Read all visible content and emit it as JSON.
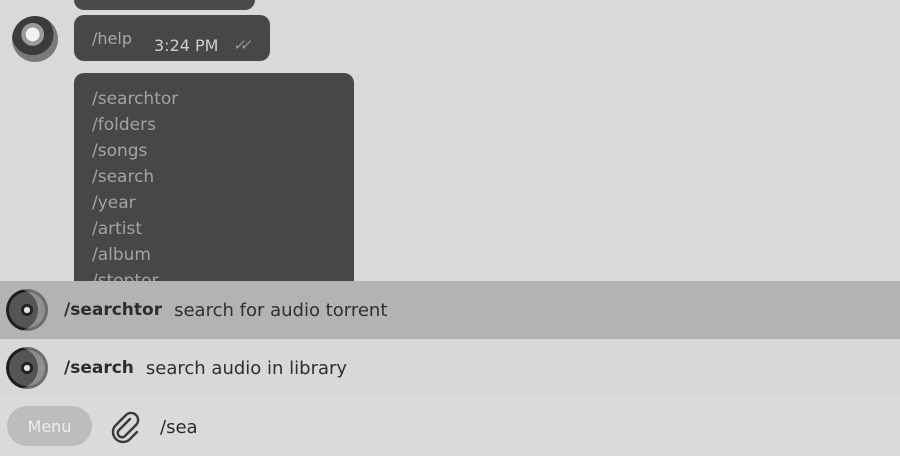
{
  "messages": {
    "help": {
      "text": "/help",
      "time": "3:24 PM",
      "status": "✓✓"
    },
    "commands_list": [
      "/searchtor",
      "/folders",
      "/songs",
      "/search",
      "/year",
      "/artist",
      "/album",
      "/stoptor"
    ]
  },
  "suggestions": [
    {
      "command": "/searchtor",
      "description": "search for audio torrent"
    },
    {
      "command": "/search",
      "description": "search audio in library"
    }
  ],
  "input_bar": {
    "menu_label": "Menu",
    "input_value": "/sea"
  }
}
